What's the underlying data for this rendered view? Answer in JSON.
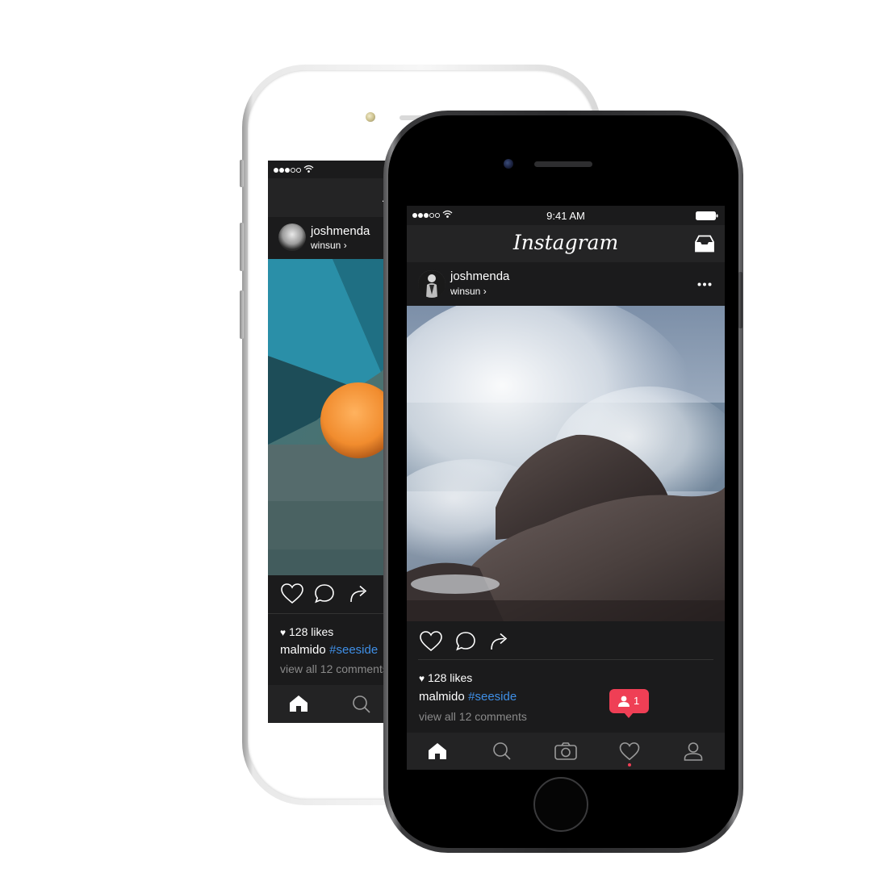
{
  "app": {
    "logo": "Instagram"
  },
  "status_bar": {
    "time": "9:41 AM"
  },
  "post": {
    "username": "joshmenda",
    "location": "winsun",
    "likes": "128 likes",
    "caption_user": "malmido",
    "hashtag": "#seeside",
    "comments_link": "view all 12 comments"
  },
  "notification": {
    "count": "1"
  },
  "icons": {
    "status": [
      "signal-dots-icon",
      "wifi-icon",
      "battery-icon"
    ],
    "header": [
      "inbox-icon",
      "more-icon"
    ],
    "actions": [
      "heart-icon",
      "comment-icon",
      "share-icon"
    ],
    "tabs": [
      "home-icon",
      "search-icon",
      "camera-icon",
      "heart-icon",
      "profile-icon"
    ]
  },
  "colors": {
    "screen_bg": "#1e1e1f",
    "text": "#ffffff",
    "hashtag": "#3f8fe6",
    "comments": "#8a8a8a",
    "badge": "#ef3f55"
  }
}
